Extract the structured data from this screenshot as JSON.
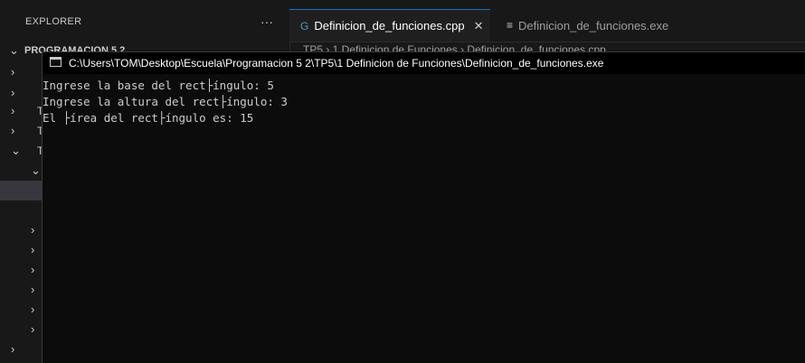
{
  "sidebar": {
    "header": "EXPLORER",
    "more": "···",
    "folder": "PROGRAMACION 5 2",
    "tree_labels": [
      "T",
      "T",
      "T"
    ]
  },
  "tabs": [
    {
      "label": "Definicion_de_funciones.cpp",
      "icon": "cpp-file-icon",
      "active": true
    },
    {
      "label": "Definicion_de_funciones.exe",
      "icon": "file-lines-icon",
      "active": false
    }
  ],
  "breadcrumb": "TP5 › 1 Definicion de Funciones › Definicion_de_funciones.cpp",
  "console": {
    "title": "C:\\Users\\TOM\\Desktop\\Escuela\\Programacion 5 2\\TP5\\1 Definicion de Funciones\\Definicion_de_funciones.exe",
    "lines": [
      "Ingrese la base del rect├íngulo: 5",
      "Ingrese la altura del rect├íngulo: 3",
      "El ├írea del rect├íngulo es: 15"
    ]
  }
}
